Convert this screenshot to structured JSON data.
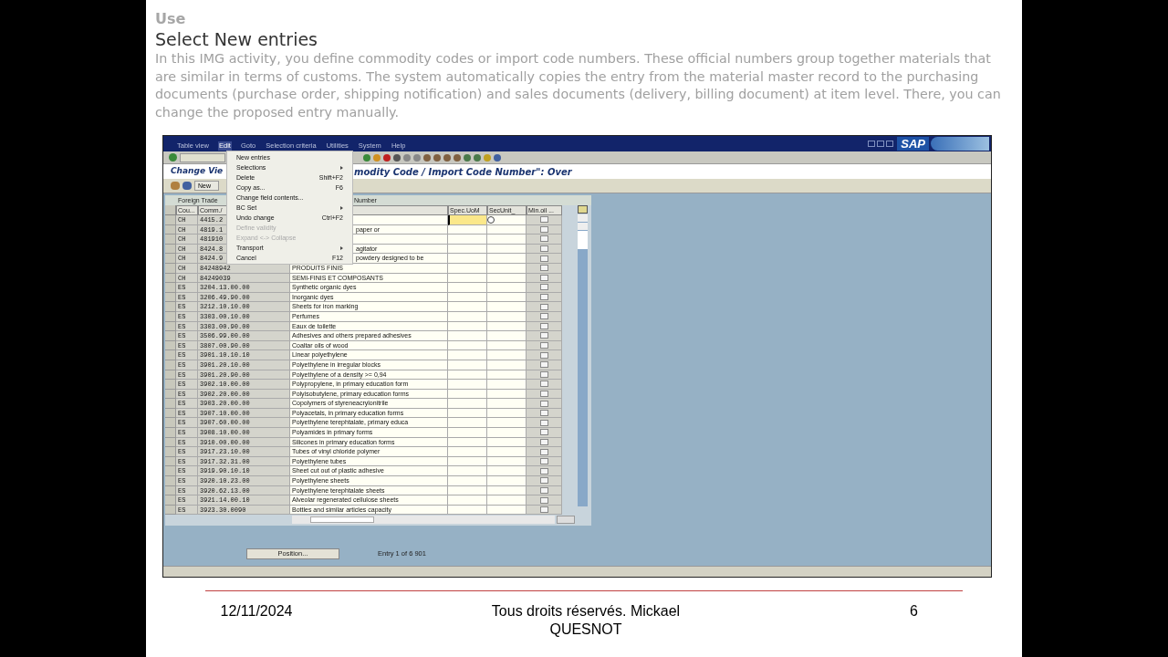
{
  "slide": {
    "heading": "Use",
    "title": "Select New entries",
    "paragraph": "In this IMG activity, you define commodity codes or import code numbers. These official numbers group together materials that are similar in terms of customs. The system automatically copies the entry from the material master record to the purchasing documents (purchase order, shipping notification) and sales documents (delivery, billing document) at item level. There, you can change the proposed entry manually."
  },
  "sap": {
    "menu_bar": [
      {
        "label": "Table view",
        "selected": false
      },
      {
        "label": "Edit",
        "selected": true
      },
      {
        "label": "Goto",
        "selected": false
      },
      {
        "label": "Selection criteria",
        "selected": false
      },
      {
        "label": "Utilities",
        "selected": false
      },
      {
        "label": "System",
        "selected": false
      },
      {
        "label": "Help",
        "selected": false
      }
    ],
    "logo": "SAP",
    "screen_title": [
      "Change Vie",
      "modity Code / Import Code Number\": Over"
    ],
    "app_toolbar_button": "New",
    "table": {
      "title": [
        "Foreign Trade",
        "Number"
      ],
      "columns": [
        "Cou...",
        "Comm./",
        "Spec.UoM",
        "SecUnit_",
        "Min.oil ..."
      ],
      "rows": [
        {
          "country": "CH",
          "code": "4415.2",
          "active": true,
          "checked": false
        },
        {
          "country": "CH",
          "code": "4819.1",
          "description": "paper or",
          "under_menu": true,
          "active": false,
          "checked": false
        },
        {
          "country": "CH",
          "code": "481910",
          "active": false,
          "checked": false
        },
        {
          "country": "CH",
          "code": "8424.8",
          "description": "agitator",
          "under_menu": true,
          "active": false,
          "checked": false
        },
        {
          "country": "CH",
          "code": "8424.9",
          "description": "powdery designed to be",
          "under_menu": true,
          "active": false,
          "checked": false
        },
        {
          "country": "CH",
          "code": "84248942",
          "description": "PRODUITS FINIS",
          "under_menu": false,
          "active": false,
          "checked": false
        },
        {
          "country": "CH",
          "code": "84249039",
          "description": "SEMI-FINIS ET COMPOSANTS",
          "under_menu": false,
          "active": false,
          "checked": false
        },
        {
          "country": "ES",
          "code": "3204.13.00.00",
          "description": "Synthetic organic dyes",
          "under_menu": false,
          "active": false,
          "checked": false
        },
        {
          "country": "ES",
          "code": "3206.49.90.00",
          "description": "Inorganic dyes",
          "under_menu": false,
          "active": false,
          "checked": false
        },
        {
          "country": "ES",
          "code": "3212.10.10.00",
          "description": "Sheets for iron marking",
          "under_menu": false,
          "active": false,
          "checked": false
        },
        {
          "country": "ES",
          "code": "3303.00.10.00",
          "description": "Perfumes",
          "under_menu": false,
          "active": false,
          "checked": false
        },
        {
          "country": "ES",
          "code": "3303.00.90.00",
          "description": "Eaux de toilette",
          "under_menu": false,
          "active": false,
          "checked": false
        },
        {
          "country": "ES",
          "code": "3506.99.00.00",
          "description": "Adhesives and others prepared adhesives",
          "under_menu": false,
          "active": false,
          "checked": false
        },
        {
          "country": "ES",
          "code": "3807.00.90.00",
          "description": "Coaltar oils of wood",
          "under_menu": false,
          "active": false,
          "checked": false
        },
        {
          "country": "ES",
          "code": "3901.10.10.10",
          "description": "Linear polyethylene",
          "under_menu": false,
          "active": false,
          "checked": false
        },
        {
          "country": "ES",
          "code": "3901.20.10.00",
          "description": "Polyethylene in irregular blocks",
          "under_menu": false,
          "active": false,
          "checked": false
        },
        {
          "country": "ES",
          "code": "3901.20.90.00",
          "description": "Polyethylene of a density >= 0,94",
          "under_menu": false,
          "active": false,
          "checked": false
        },
        {
          "country": "ES",
          "code": "3902.10.00.00",
          "description": "Polypropylene, in primary education form",
          "under_menu": false,
          "active": false,
          "checked": false
        },
        {
          "country": "ES",
          "code": "3902.20.00.00",
          "description": "Polyisobutylene, primary education forms",
          "under_menu": false,
          "active": false,
          "checked": false
        },
        {
          "country": "ES",
          "code": "3903.20.00.00",
          "description": "Copolymers of styreneacrylonitrile",
          "under_menu": false,
          "active": false,
          "checked": false
        },
        {
          "country": "ES",
          "code": "3907.10.00.00",
          "description": "Polyacetals, in primary education forms",
          "under_menu": false,
          "active": false,
          "checked": false
        },
        {
          "country": "ES",
          "code": "3907.60.00.00",
          "description": "Polyethylene terephtalate, primary educa",
          "under_menu": false,
          "active": false,
          "checked": false
        },
        {
          "country": "ES",
          "code": "3908.10.00.00",
          "description": "Polyamides in primary forms",
          "under_menu": false,
          "active": false,
          "checked": false
        },
        {
          "country": "ES",
          "code": "3910.00.00.00",
          "description": "Silicones in primary education forms",
          "under_menu": false,
          "active": false,
          "checked": false
        },
        {
          "country": "ES",
          "code": "3917.23.10.00",
          "description": "Tubes of vinyl chloride polymer",
          "under_menu": false,
          "active": false,
          "checked": false
        },
        {
          "country": "ES",
          "code": "3917.32.31.00",
          "description": "Polyethylene tubes",
          "under_menu": false,
          "active": false,
          "checked": false
        },
        {
          "country": "ES",
          "code": "3919.90.10.10",
          "description": "Sheet cut out of plastic adhesive",
          "under_menu": false,
          "active": false,
          "checked": false
        },
        {
          "country": "ES",
          "code": "3920.10.23.00",
          "description": "Polyethylene sheets",
          "under_menu": false,
          "active": false,
          "checked": false
        },
        {
          "country": "ES",
          "code": "3920.62.13.00",
          "description": "Polyethylene terephtalate sheets",
          "under_menu": false,
          "active": false,
          "checked": false
        },
        {
          "country": "ES",
          "code": "3921.14.00.10",
          "description": "Alveolar regenerated cellulose sheets",
          "under_menu": false,
          "active": false,
          "checked": false
        },
        {
          "country": "ES",
          "code": "3923.30.0090",
          "description": "Bottles and similar articles capacity",
          "under_menu": false,
          "active": false,
          "checked": false
        }
      ]
    },
    "edit_menu": [
      {
        "label": "New entries",
        "submenu": false,
        "disabled": false
      },
      {
        "label": "Selections",
        "submenu": true,
        "disabled": false
      },
      {
        "label": "Delete",
        "shortcut": "Shift+F2",
        "submenu": false,
        "disabled": false
      },
      {
        "label": "Copy as...",
        "shortcut": "F6",
        "submenu": false,
        "disabled": false
      },
      {
        "label": "Change field contents...",
        "submenu": false,
        "disabled": false
      },
      {
        "label": "BC Set",
        "submenu": true,
        "disabled": false
      },
      {
        "label": "Undo change",
        "shortcut": "Ctrl+F2",
        "submenu": false,
        "disabled": false
      },
      {
        "label": "Define validity",
        "submenu": false,
        "disabled": true
      },
      {
        "label": "Expand <-> Collapse",
        "submenu": false,
        "disabled": true
      },
      {
        "label": "Transport",
        "submenu": true,
        "disabled": false
      },
      {
        "label": "Cancel",
        "shortcut": "F12",
        "submenu": false,
        "disabled": false
      }
    ],
    "position_button": "Position...",
    "entry_count": "Entry 1 of 6 901"
  },
  "footer": {
    "date": "12/11/2024",
    "rights": "Tous droits réservés. Mickael QUESNOT",
    "page": "6"
  }
}
